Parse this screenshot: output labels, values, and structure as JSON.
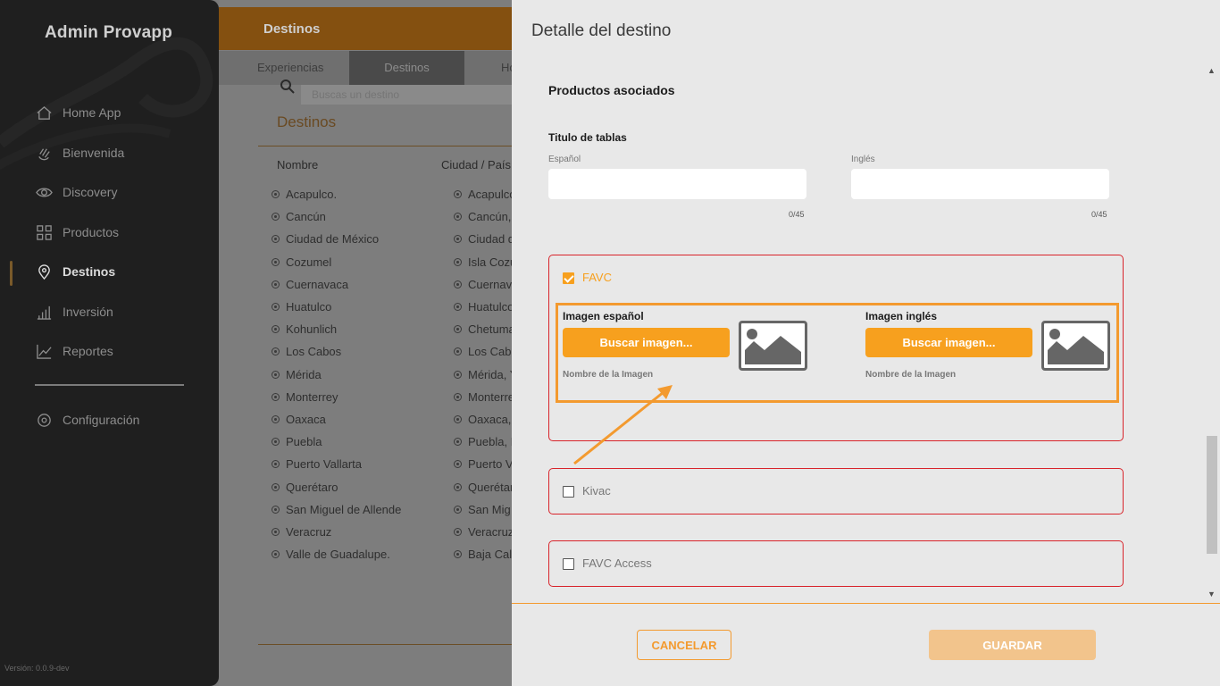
{
  "sidebar": {
    "brand": "Admin Provapp",
    "items": [
      {
        "label": "Home App",
        "icon": "home-icon"
      },
      {
        "label": "Bienvenida",
        "icon": "wave-hand-icon"
      },
      {
        "label": "Discovery",
        "icon": "eye-icon"
      },
      {
        "label": "Productos",
        "icon": "grid-icon"
      },
      {
        "label": "Destinos",
        "icon": "map-pin-icon",
        "active": true
      },
      {
        "label": "Inversión",
        "icon": "bar-chart-icon"
      },
      {
        "label": "Reportes",
        "icon": "line-chart-icon"
      }
    ],
    "settings": "Configuración",
    "version": "Versión: 0.0.9-dev"
  },
  "main": {
    "title": "Destinos",
    "tabs": [
      "Experiencias",
      "Destinos",
      "Ho"
    ],
    "search_placeholder": "Buscas un destino",
    "section_title": "Destinos",
    "columns": [
      "Nombre",
      "Ciudad / País"
    ],
    "rows": [
      [
        "Acapulco.",
        "Acapulco"
      ],
      [
        "Cancún",
        "Cancún,"
      ],
      [
        "Ciudad de México",
        "Ciudad d"
      ],
      [
        "Cozumel",
        "Isla Cozu"
      ],
      [
        "Cuernavaca",
        "Cuernava"
      ],
      [
        "Huatulco",
        "Huatulco"
      ],
      [
        "Kohunlich",
        "Chetuma"
      ],
      [
        "Los Cabos",
        "Los Cab"
      ],
      [
        "Mérida",
        "Mérida, Y"
      ],
      [
        "Monterrey",
        "Monterre"
      ],
      [
        "Oaxaca",
        "Oaxaca,"
      ],
      [
        "Puebla",
        "Puebla, P"
      ],
      [
        "Puerto Vallarta",
        "Puerto V"
      ],
      [
        "Querétaro",
        "Querétar"
      ],
      [
        "San Miguel de Allende",
        "San Mig"
      ],
      [
        "Veracruz",
        "Veracruz"
      ],
      [
        "Valle de Guadalupe.",
        "Baja Cal"
      ]
    ]
  },
  "modal": {
    "title": "Detalle del destino",
    "products_heading": "Productos asociados",
    "table_titles_heading": "Titulo de tablas",
    "spanish_label": "Español",
    "english_label": "Inglés",
    "spanish_counter": "0/45",
    "english_counter": "0/45",
    "favc": {
      "label": "FAVC",
      "checked": true,
      "image_es_label": "Imagen español",
      "image_en_label": "Imagen inglés",
      "search_button": "Buscar imagen...",
      "image_name": "Nombre de la Imagen"
    },
    "kivac": {
      "label": "Kivac",
      "checked": false
    },
    "favc_access": {
      "label": "FAVC Access",
      "checked": false
    },
    "cancel": "CANCELAR",
    "save": "GUARDAR"
  },
  "colors": {
    "accent": "#f7a01e",
    "card_border": "#d8232a",
    "sidebar_bg": "#1f1f1f"
  }
}
